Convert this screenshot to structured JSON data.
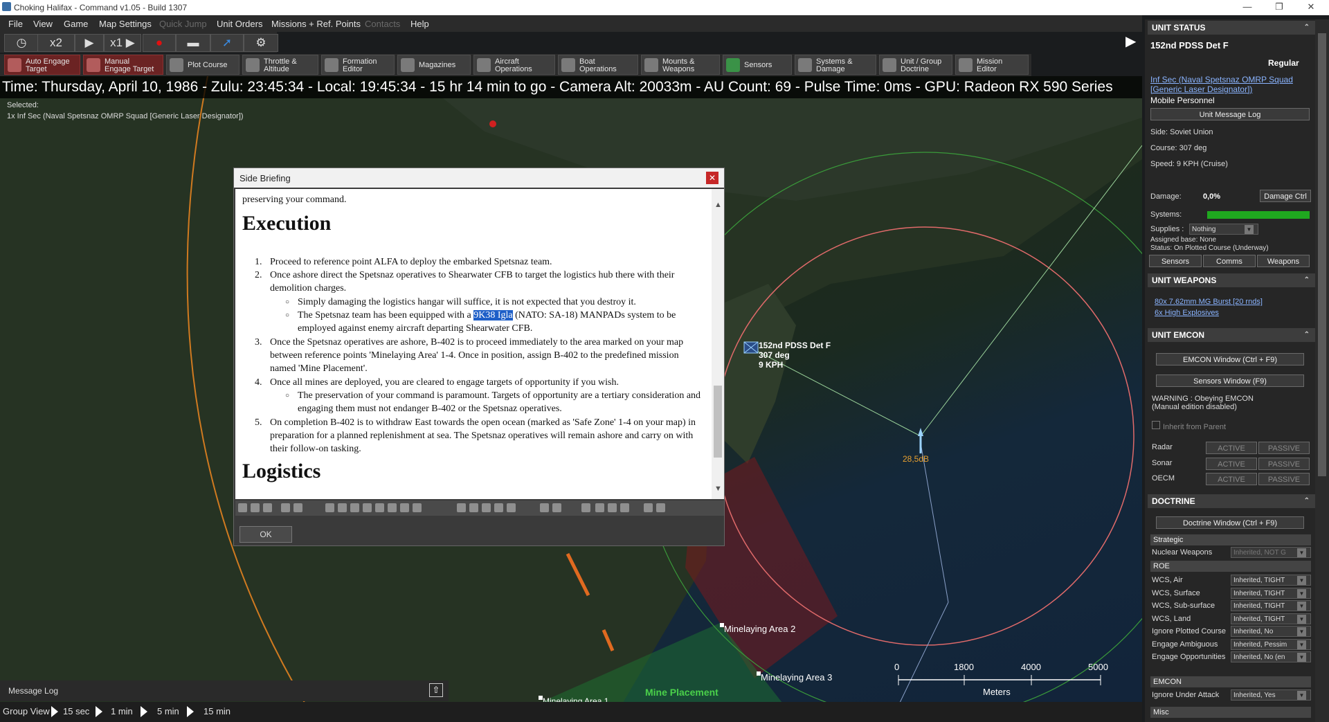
{
  "window": {
    "title": "Choking Halifax - Command v1.05 - Build 1307",
    "minimize": "—",
    "maximize": "❐",
    "close": "✕"
  },
  "menu": [
    "File",
    "View",
    "Game",
    "Map Settings",
    "Quick Jump",
    "Unit Orders",
    "Missions + Ref. Points",
    "Contacts",
    "Help"
  ],
  "menu_disabled": [
    "Quick Jump",
    "Contacts"
  ],
  "speed": {
    "time_compress": "x2",
    "play_rate": "x1"
  },
  "toolbar": [
    {
      "label1": "Auto Engage",
      "label2": "Target",
      "style": "red"
    },
    {
      "label1": "Manual",
      "label2": "Engage Target",
      "style": "red"
    },
    {
      "label1": "Plot Course",
      "label2": "",
      "style": "normal"
    },
    {
      "label1": "Throttle &",
      "label2": "Altitude",
      "style": "normal"
    },
    {
      "label1": "Formation",
      "label2": "Editor",
      "style": "normal"
    },
    {
      "label1": "Magazines",
      "label2": "",
      "style": "normal"
    },
    {
      "label1": "Aircraft",
      "label2": "Operations",
      "style": "normal"
    },
    {
      "label1": "Boat",
      "label2": "Operations",
      "style": "normal"
    },
    {
      "label1": "Mounts &",
      "label2": "Weapons",
      "style": "normal"
    },
    {
      "label1": "Sensors",
      "label2": "",
      "style": "normal"
    },
    {
      "label1": "Systems &",
      "label2": "Damage",
      "style": "normal"
    },
    {
      "label1": "Unit / Group",
      "label2": "Doctrine",
      "style": "normal"
    },
    {
      "label1": "Mission",
      "label2": "Editor",
      "style": "normal"
    }
  ],
  "status_line": "Time: Thursday, April 10, 1986 - Zulu: 23:45:34 - Local: 19:45:34 - 15 hr 14 min to go -  Camera Alt: 20033m  - AU Count: 69 - Pulse Time: 0ms - GPU: Radeon RX 590 Series",
  "selected": {
    "label": "Selected:",
    "value": "1x Inf Sec (Naval Spetsnaz OMRP Squad [Generic Laser Designator])"
  },
  "map": {
    "unit_label": [
      "152nd PDSS Det F",
      "307 deg",
      "9 KPH"
    ],
    "contact_label": "28,5dB",
    "areas": [
      "Minelaying Area 2",
      "Minelaying Area 3",
      "Minelaying Area 1",
      "Mine Placement"
    ],
    "scale_ticks": [
      "0",
      "1800",
      "4000",
      "5000"
    ],
    "scale_unit": "Meters"
  },
  "briefing": {
    "title": "Side Briefing",
    "top_text": "preserving your command.",
    "execution_heading": "Execution",
    "items": [
      {
        "n": "1.",
        "text": "Proceed to reference point ALFA to deploy the embarked Spetsnaz team."
      },
      {
        "n": "2.",
        "text": "Once ashore direct the Spetsnaz operatives to Shearwater CFB to target the logistics hub there with their demolition charges."
      },
      {
        "n": "3.",
        "text": "Once the Spetsnaz operatives are ashore, B-402 is to proceed immediately to the area marked on your map between reference points 'Minelaying Area' 1-4. Once in position, assign B-402 to the predefined mission named 'Mine Placement'."
      },
      {
        "n": "4.",
        "text": "Once all mines are deployed, you are cleared to engage targets of opportunity if you wish."
      },
      {
        "n": "5.",
        "text": "On completion B-402 is to withdraw East towards the open ocean (marked as 'Safe Zone' 1-4 on your map) in preparation for a planned replenishment at sea. The Spetsnaz operatives will remain ashore and carry on with their follow-on tasking."
      }
    ],
    "sub2a": "Simply damaging the logistics hangar will suffice, it is not expected that you destroy it.",
    "sub2b_pre": "The Spetsnaz team has been equipped with a ",
    "sub2b_hl": "9K38 Igla",
    "sub2b_post": " (NATO: SA-18) MANPADs system to be employed against enemy aircraft departing Shearwater CFB.",
    "sub4a": "The preservation of your command is paramount. Targets of opportunity are a tertiary consideration and engaging them must not endanger B-402 or the Spetsnaz operatives.",
    "logistics_heading": "Logistics",
    "ok": "OK"
  },
  "bottom": {
    "message_log": "Message Log",
    "group_view": "Group View",
    "intervals": [
      "15 sec",
      "1 min",
      "5 min",
      "15 min"
    ]
  },
  "panel": {
    "unit_status": "UNIT STATUS",
    "unit_name": "152nd PDSS Det F",
    "proficiency": "Regular",
    "unit_link": "Inf Sec (Naval Spetsnaz OMRP Squad [Generic Laser Designator])",
    "unit_link_l1": "Inf Sec (Naval Spetsnaz OMRP Squad",
    "unit_link_l2": "[Generic Laser Designator])",
    "unit_type": "Mobile Personnel",
    "msg_log_btn": "Unit Message Log",
    "side": "Side: Soviet Union",
    "course": "Course: 307 deg",
    "speed": "Speed: 9 KPH (Cruise)",
    "damage_label": "Damage:",
    "damage_value": "0,0%",
    "damage_btn": "Damage Ctrl",
    "systems_label": "Systems:",
    "systems_level": 1.0,
    "supplies_label": "Supplies :",
    "supplies_value": "Nothing",
    "assigned_base": "Assigned base: None",
    "status": "Status: On Plotted Course (Underway)",
    "tabs": [
      "Sensors",
      "Comms",
      "Weapons"
    ],
    "unit_weapons": "UNIT WEAPONS",
    "weapons": [
      "80x 7.62mm MG Burst [20 rnds]",
      "6x High Explosives"
    ],
    "unit_emcon": "UNIT EMCON",
    "emcon_btn": "EMCON Window (Ctrl + F9)",
    "sensors_btn": "Sensors Window (F9)",
    "warning1": "WARNING : Obeying EMCON",
    "warning2": "(Manual edition disabled)",
    "inherit": "Inherit from Parent",
    "emcon_rows": [
      {
        "label": "Radar",
        "active": "ACTIVE",
        "passive": "PASSIVE"
      },
      {
        "label": "Sonar",
        "active": "ACTIVE",
        "passive": "PASSIVE"
      },
      {
        "label": "OECM",
        "active": "ACTIVE",
        "passive": "PASSIVE"
      }
    ],
    "doctrine": "DOCTRINE",
    "doctrine_btn": "Doctrine Window (Ctrl + F9)",
    "strategic": "Strategic",
    "nuclear": {
      "label": "Nuclear Weapons",
      "value": "Inherited, NOT G"
    },
    "roe": "ROE",
    "roe_rows": [
      {
        "label": "WCS, Air",
        "value": "Inherited, TIGHT"
      },
      {
        "label": "WCS, Surface",
        "value": "Inherited, TIGHT"
      },
      {
        "label": "WCS, Sub-surface",
        "value": "Inherited, TIGHT"
      },
      {
        "label": "WCS, Land",
        "value": "Inherited, TIGHT"
      },
      {
        "label": "Ignore Plotted Course",
        "value": "Inherited, No"
      },
      {
        "label": "Engage Ambiguous",
        "value": "Inherited, Pessim"
      },
      {
        "label": "Engage Opportunities",
        "value": "Inherited, No (en"
      }
    ],
    "emcon_section": "EMCON",
    "ignore_attack": {
      "label": "Ignore Under Attack",
      "value": "Inherited, Yes"
    },
    "misc": "Misc"
  },
  "colors": {
    "accent": "#1e5fc8",
    "danger": "#c62828",
    "systems_ok": "#1fa81f",
    "link": "#8ab4ff"
  }
}
